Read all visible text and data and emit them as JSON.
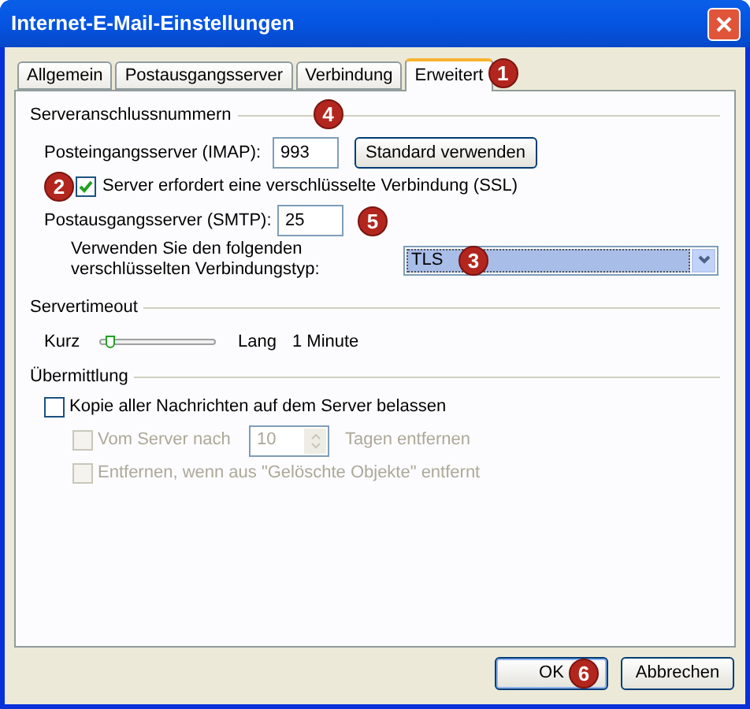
{
  "window": {
    "title": "Internet-E-Mail-Einstellungen"
  },
  "tabs": [
    {
      "label": "Allgemein",
      "selected": false
    },
    {
      "label": "Postausgangsserver",
      "selected": false
    },
    {
      "label": "Verbindung",
      "selected": false
    },
    {
      "label": "Erweitert",
      "selected": true,
      "callout": "1"
    }
  ],
  "ports": {
    "heading": "Serveranschlussnummern",
    "callout": "4",
    "imap": {
      "label": "Posteingangsserver (IMAP):",
      "value": "993"
    },
    "default_button": "Standard verwenden",
    "ssl": {
      "label": "Server erfordert eine verschlüsselte Verbindung (SSL)",
      "checked": true,
      "callout": "2"
    },
    "smtp": {
      "label": "Postausgangsserver (SMTP):",
      "value": "25",
      "callout": "5"
    },
    "encryption": {
      "label": "Verwenden Sie den folgenden verschlüsselten Verbindungstyp:",
      "value": "TLS",
      "callout": "3"
    }
  },
  "timeout": {
    "heading": "Servertimeout",
    "min_label": "Kurz",
    "max_label": "Lang",
    "level": 0.05,
    "reading": "1 Minute"
  },
  "delivery": {
    "heading": "Übermittlung",
    "options": [
      {
        "kind": "checkbox",
        "label": "Kopie aller Nachrichten auf dem Server belassen",
        "checked": false,
        "disabled": false
      },
      {
        "kind": "spin",
        "label": "Vom Server nach",
        "value": "10",
        "suffix": "Tagen entfernen",
        "checked": false,
        "disabled": true
      },
      {
        "kind": "checkbox",
        "label": "Entfernen, wenn aus \"Gelöschte Objekte\" entfernt",
        "checked": false,
        "disabled": true
      }
    ]
  },
  "buttons": [
    {
      "label": "OK",
      "default": true,
      "callout": "6"
    },
    {
      "label": "Abbrechen",
      "default": false
    }
  ]
}
